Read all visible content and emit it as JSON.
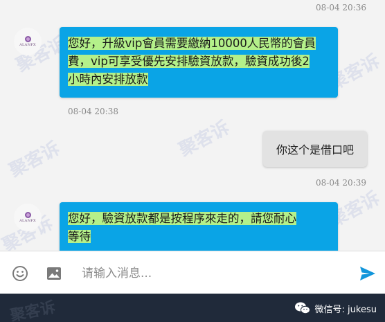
{
  "chat": {
    "messages": [
      {
        "type": "timestamp",
        "text": "08-04 20:36"
      },
      {
        "type": "incoming",
        "avatar_text": "ALANFX",
        "lines": [
          "您好，升級vip會員需要繳納10000人民幣的會員",
          "費，vip可享受優先安排驗資放款，驗資成功後2",
          "小時內安排放款"
        ],
        "time": "08-04 20:38"
      },
      {
        "type": "outgoing",
        "text": "你这个是借口吧",
        "time": "08-04 20:39"
      },
      {
        "type": "incoming",
        "avatar_text": "ALANFX",
        "lines": [
          "您好，驗資放款都是按程序來走的，請您耐心",
          "等待"
        ]
      }
    ]
  },
  "watermark": "聚客诉",
  "input_bar": {
    "emoji_icon": "emoji-icon",
    "image_icon": "image-icon",
    "placeholder": "请输入消息...",
    "send_icon": "send-icon",
    "accent": "#1296db"
  },
  "footer": {
    "wechat_label": "微信号: jukesu",
    "background": "#202a3a"
  },
  "colors": {
    "incoming_bubble": "#0aa4e6",
    "highlight": "#b4f08a",
    "outgoing_bubble": "#e2e2e2"
  }
}
